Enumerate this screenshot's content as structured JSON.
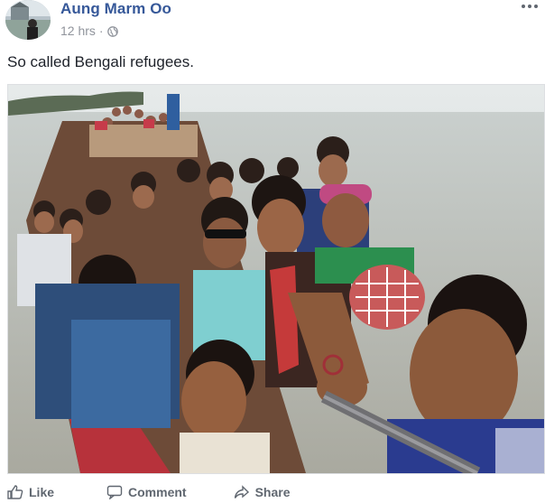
{
  "post": {
    "author_name": "Aung Marm Oo",
    "timestamp": "12 hrs",
    "separator": "·",
    "privacy_icon": "globe-icon",
    "more_icon": "more-options-icon",
    "text": "So called Bengali refugees."
  },
  "actions": {
    "like_label": "Like",
    "comment_label": "Comment",
    "share_label": "Share"
  },
  "colors": {
    "author_link": "#365899",
    "meta_gray": "#90949c",
    "action_gray": "#606770"
  }
}
